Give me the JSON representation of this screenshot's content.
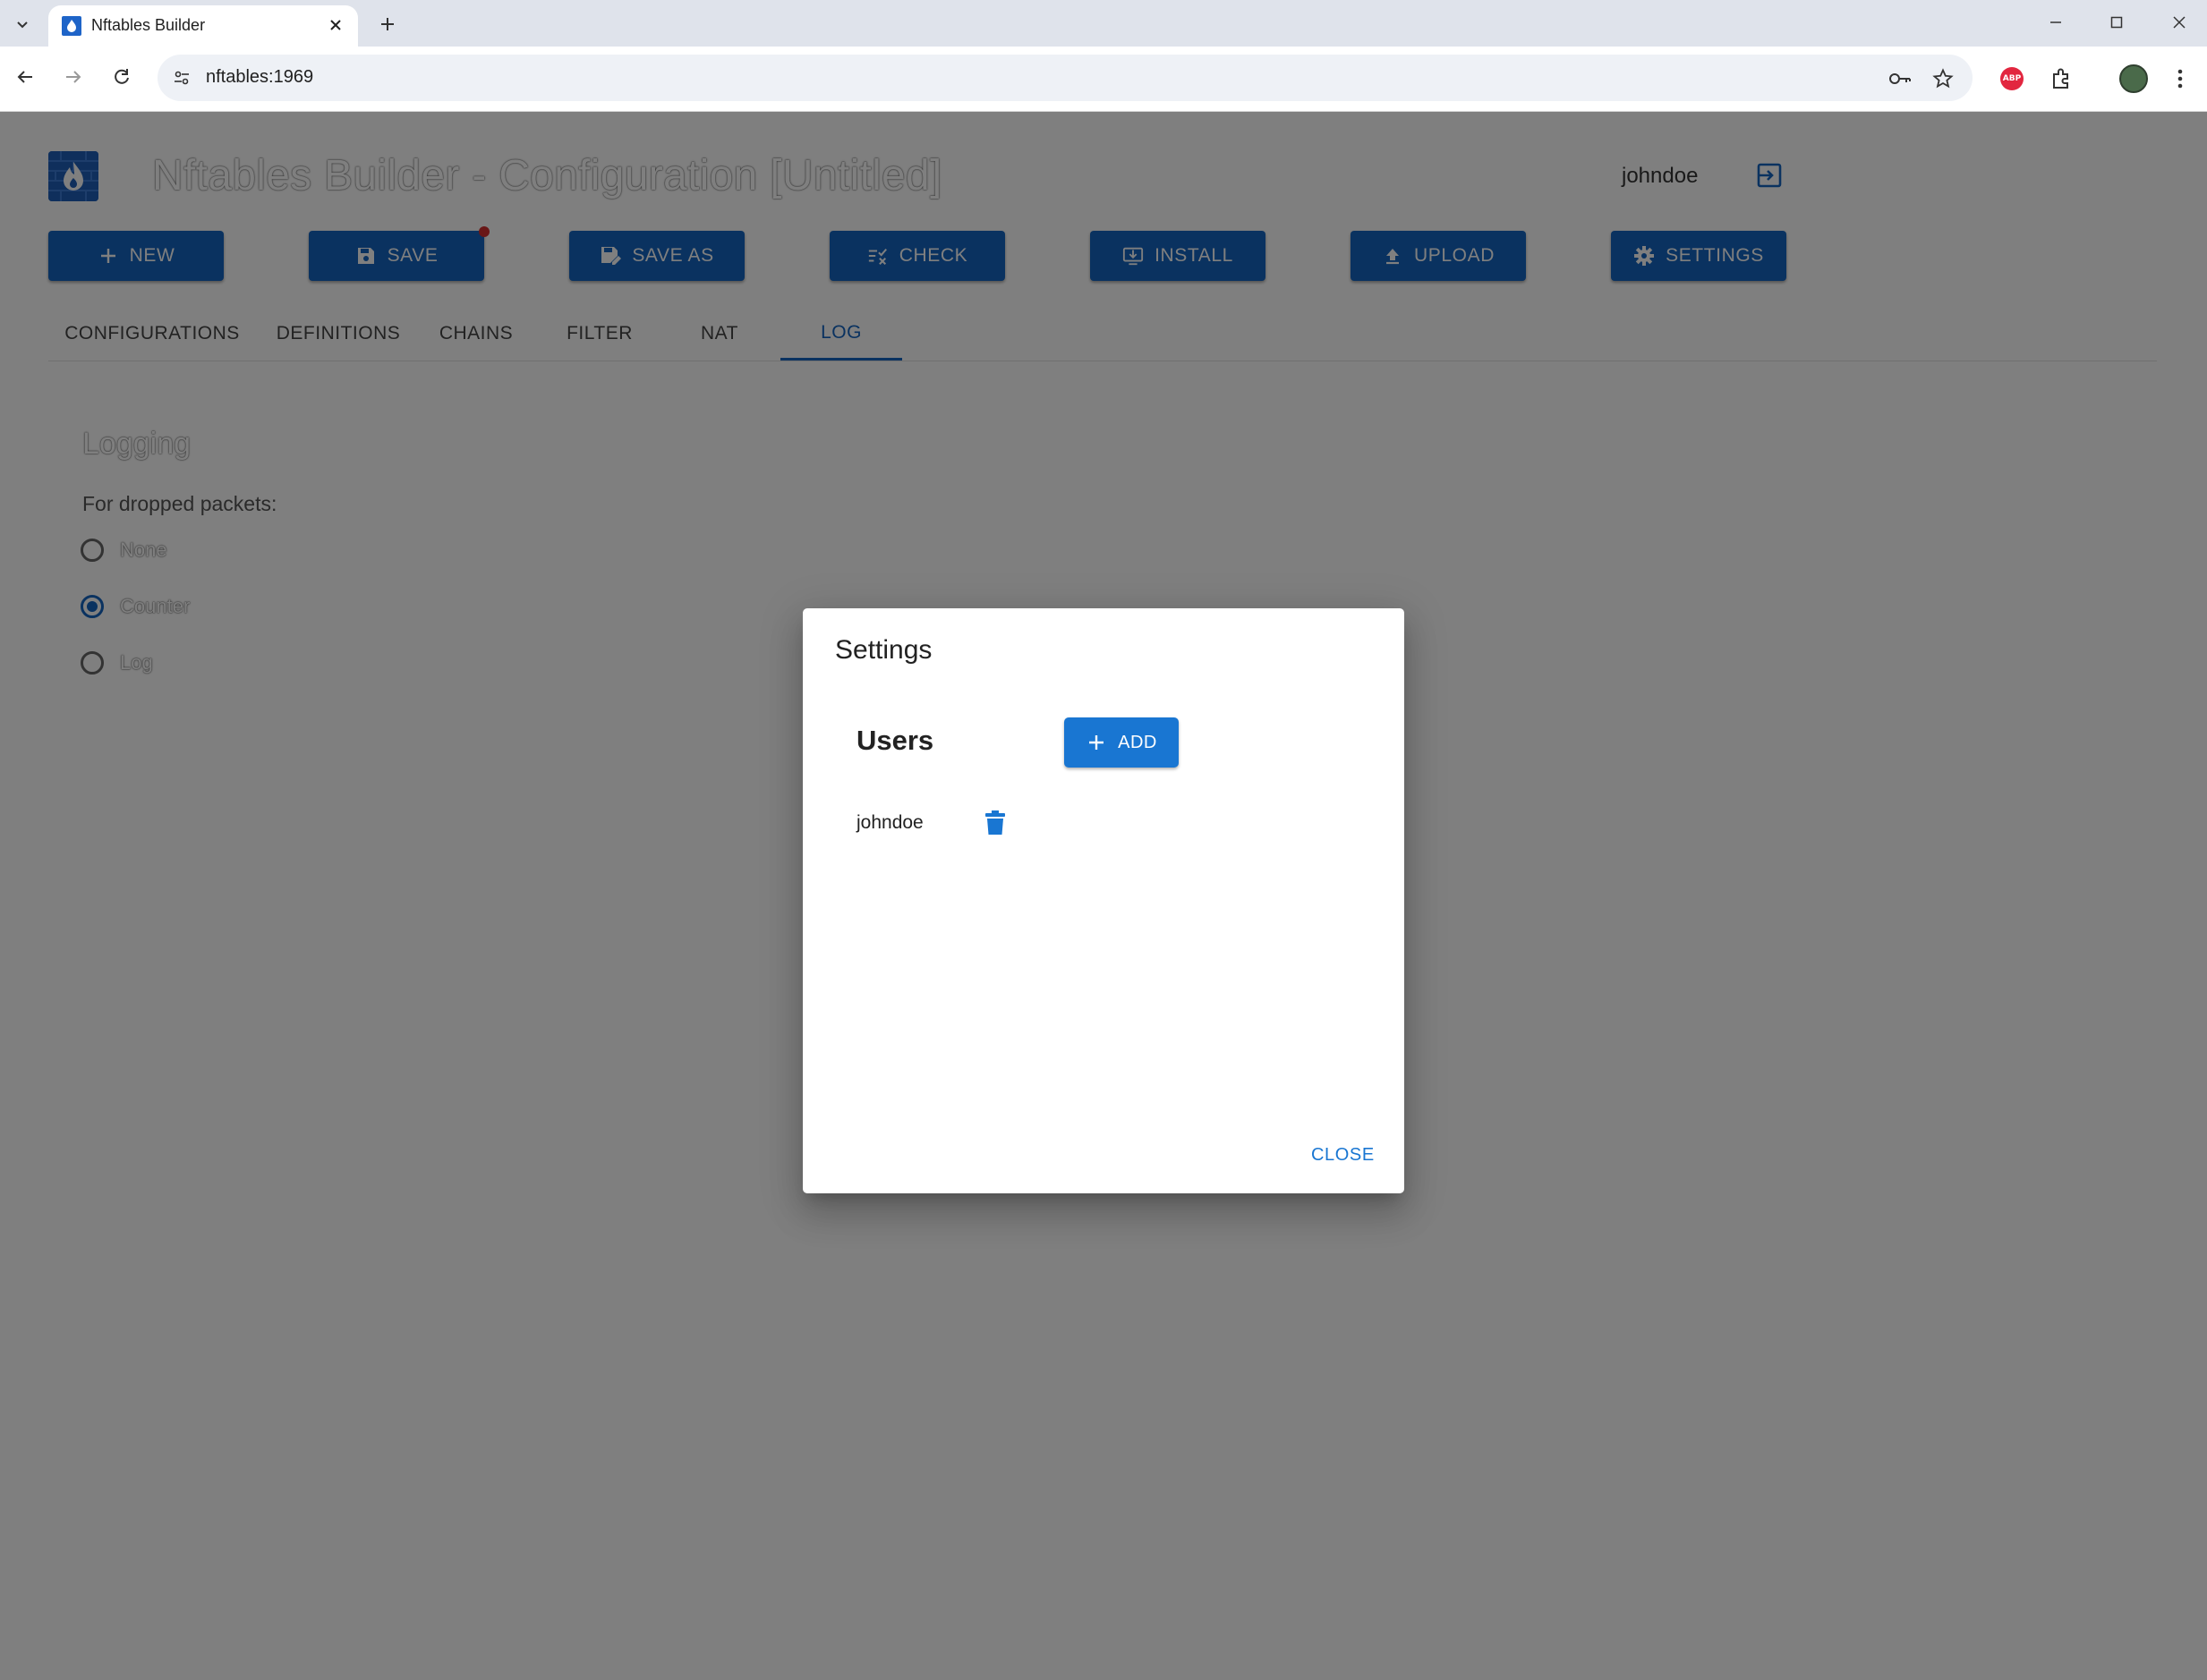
{
  "browser": {
    "tab_title": "Nftables Builder",
    "url": "nftables:1969",
    "extension_abp_label": "ABP"
  },
  "app": {
    "title": "Nftables Builder - Configuration [Untitled]",
    "username": "johndoe",
    "toolbar": {
      "new_label": "NEW",
      "save_label": "SAVE",
      "save_as_label": "SAVE AS",
      "check_label": "CHECK",
      "install_label": "INSTALL",
      "upload_label": "UPLOAD",
      "settings_label": "SETTINGS"
    },
    "tabs": [
      {
        "label": "CONFIGURATIONS"
      },
      {
        "label": "DEFINITIONS"
      },
      {
        "label": "CHAINS"
      },
      {
        "label": "FILTER"
      },
      {
        "label": "NAT"
      },
      {
        "label": "LOG",
        "active": true
      }
    ],
    "logging": {
      "title": "Logging",
      "label": "For dropped packets:",
      "options": [
        {
          "label": "None",
          "selected": false
        },
        {
          "label": "Counter",
          "selected": true
        },
        {
          "label": "Log",
          "selected": false
        }
      ]
    }
  },
  "dialog": {
    "title": "Settings",
    "users_heading": "Users",
    "add_label": "ADD",
    "users": [
      {
        "name": "johndoe"
      }
    ],
    "close_label": "CLOSE"
  },
  "colors": {
    "primary": "#1565c0",
    "dialog_button": "#1976d2",
    "dirty_indicator": "#d32f2f"
  }
}
